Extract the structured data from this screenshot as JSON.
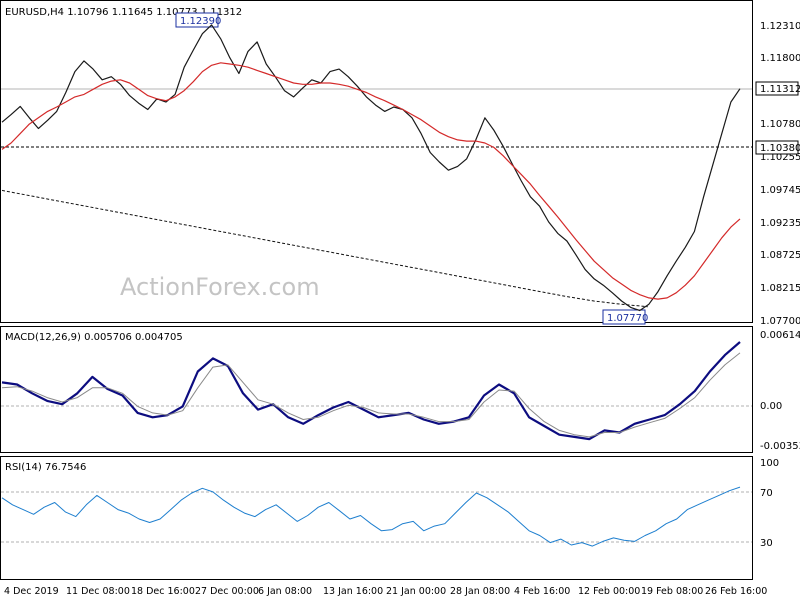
{
  "chart_data": [
    {
      "type": "line",
      "title": "EURUSD,H4  1.10796 1.11645 1.10773 1.11312",
      "ylim": [
        1.0765,
        1.1265
      ],
      "yticks": [
        "1.12310",
        "1.11800",
        "1.11312",
        "1.10780",
        "1.10380",
        "1.10255",
        "1.09745",
        "1.09235",
        "1.08725",
        "1.08215",
        "1.07700"
      ],
      "current_price": "1.11312",
      "horizontal_line_label": "1.10380",
      "high_label": "1.12390",
      "low_label": "1.07770",
      "watermark": "ActionForex.com",
      "x_labels": [
        "4 Dec 2019",
        "11 Dec 08:00",
        "18 Dec 16:00",
        "27 Dec 00:00",
        "6 Jan 08:00",
        "13 Jan 16:00",
        "21 Jan 00:00",
        "28 Jan 08:00",
        "4 Feb 16:00",
        "12 Feb 00:00",
        "19 Feb 08:00",
        "26 Feb 16:00"
      ],
      "series": [
        {
          "name": "price",
          "color": "#1a1a1a",
          "values": [
            1.1078,
            1.109,
            1.1103,
            1.1085,
            1.1068,
            1.1081,
            1.1095,
            1.1125,
            1.1158,
            1.1175,
            1.1162,
            1.1145,
            1.115,
            1.1138,
            1.112,
            1.1108,
            1.1098,
            1.1115,
            1.111,
            1.1122,
            1.1165,
            1.1192,
            1.1218,
            1.1232,
            1.121,
            1.118,
            1.1155,
            1.119,
            1.1205,
            1.117,
            1.115,
            1.1128,
            1.1118,
            1.1132,
            1.1145,
            1.114,
            1.1158,
            1.1162,
            1.115,
            1.1135,
            1.1118,
            1.1105,
            1.1095,
            1.1102,
            1.1098,
            1.1085,
            1.106,
            1.103,
            1.1015,
            1.1002,
            1.1008,
            1.102,
            1.105,
            1.1085,
            1.1065,
            1.104,
            1.1012,
            1.0985,
            1.096,
            1.0945,
            1.092,
            1.0902,
            1.089,
            1.0868,
            1.0845,
            1.083,
            1.082,
            1.0808,
            1.0795,
            1.0785,
            1.078,
            1.079,
            1.081,
            1.0835,
            1.0858,
            1.088,
            1.0905,
            1.096,
            1.101,
            1.106,
            1.111,
            1.1131
          ]
        },
        {
          "name": "ma-red",
          "color": "#d42a2a",
          "values": [
            1.1035,
            1.1045,
            1.106,
            1.1075,
            1.1085,
            1.1095,
            1.1102,
            1.111,
            1.1118,
            1.1122,
            1.113,
            1.1138,
            1.1143,
            1.1145,
            1.114,
            1.113,
            1.112,
            1.1115,
            1.1112,
            1.1118,
            1.1128,
            1.1142,
            1.1158,
            1.1168,
            1.1172,
            1.117,
            1.1168,
            1.1165,
            1.116,
            1.1155,
            1.115,
            1.1145,
            1.114,
            1.1138,
            1.1138,
            1.114,
            1.114,
            1.1138,
            1.1135,
            1.113,
            1.1125,
            1.1118,
            1.1112,
            1.1105,
            1.1098,
            1.109,
            1.1082,
            1.1072,
            1.1062,
            1.1055,
            1.105,
            1.1048,
            1.1048,
            1.1045,
            1.1038,
            1.1025,
            1.101,
            1.0995,
            1.098,
            1.0962,
            1.0945,
            1.0928,
            1.091,
            1.0892,
            1.0875,
            1.0858,
            1.0845,
            1.0832,
            1.0822,
            1.0812,
            1.0805,
            1.08,
            1.0798,
            1.08,
            1.0808,
            1.082,
            1.0835,
            1.0855,
            1.0875,
            1.0895,
            1.0912,
            1.0925
          ]
        },
        {
          "name": "ma-long",
          "color": "#111111",
          "values": [
            1.097,
            1.0962,
            1.0954,
            1.0946,
            1.0938,
            1.093,
            1.0922,
            1.0914,
            1.0906,
            1.0898,
            1.089,
            1.0882,
            1.0874,
            1.0866,
            1.0858,
            1.085,
            1.0842,
            1.0834,
            1.0826,
            1.0818,
            1.081,
            1.0802,
            1.0795,
            1.079,
            1.0786
          ]
        }
      ]
    },
    {
      "type": "line",
      "title": "MACD(12,26,9) 0.005706 0.004705",
      "ylim": [
        -0.0042,
        0.0068
      ],
      "yticks": [
        "0.006146",
        "0.00",
        "-0.003535"
      ],
      "zero_label": "0.00",
      "series": [
        {
          "name": "macd",
          "color": "#0d0d80",
          "values": [
            0.002,
            0.0018,
            0.001,
            0.0003,
            0.0,
            0.001,
            0.0025,
            0.0014,
            0.0008,
            -0.0008,
            -0.0012,
            -0.001,
            -0.0002,
            0.003,
            0.0042,
            0.0035,
            0.001,
            -0.0005,
            0.0,
            -0.0012,
            -0.0018,
            -0.001,
            -0.0003,
            0.0002,
            -0.0005,
            -0.0012,
            -0.001,
            -0.0008,
            -0.0014,
            -0.0018,
            -0.0016,
            -0.0012,
            0.0008,
            0.0018,
            0.001,
            -0.0012,
            -0.002,
            -0.0028,
            -0.003,
            -0.0032,
            -0.0024,
            -0.0026,
            -0.0018,
            -0.0014,
            -0.001,
            0.0,
            0.0012,
            0.003,
            0.0045,
            0.0057
          ]
        },
        {
          "name": "signal",
          "color": "#8a8a8a",
          "values": [
            0.0015,
            0.0016,
            0.0012,
            0.0006,
            0.0002,
            0.0006,
            0.0015,
            0.0015,
            0.001,
            -0.0002,
            -0.0008,
            -0.001,
            -0.0006,
            0.0015,
            0.0034,
            0.0036,
            0.002,
            0.0004,
            0.0,
            -0.0008,
            -0.0014,
            -0.0012,
            -0.0006,
            -0.0001,
            -0.0003,
            -0.0008,
            -0.0009,
            -0.0009,
            -0.0012,
            -0.0016,
            -0.0016,
            -0.0014,
            0.0002,
            0.0013,
            0.0012,
            -0.0004,
            -0.0016,
            -0.0024,
            -0.0028,
            -0.003,
            -0.0026,
            -0.0026,
            -0.0021,
            -0.0017,
            -0.0013,
            -0.0004,
            0.0006,
            0.0022,
            0.0036,
            0.0047
          ]
        }
      ]
    },
    {
      "type": "line",
      "title": "RSI(14) 76.7546",
      "ylim": [
        0,
        100
      ],
      "yticks": [
        "100",
        "70",
        "30",
        "0"
      ],
      "levels": [
        70,
        30
      ],
      "series": [
        {
          "name": "rsi",
          "color": "#1e7fcf",
          "values": [
            68,
            62,
            58,
            54,
            60,
            64,
            56,
            52,
            62,
            70,
            64,
            58,
            55,
            50,
            47,
            50,
            58,
            66,
            72,
            76,
            73,
            66,
            60,
            55,
            52,
            58,
            62,
            55,
            48,
            53,
            60,
            64,
            57,
            50,
            53,
            46,
            40,
            41,
            46,
            48,
            40,
            44,
            46,
            55,
            64,
            72,
            68,
            62,
            56,
            48,
            40,
            36,
            30,
            33,
            28,
            30,
            27,
            31,
            34,
            32,
            31,
            36,
            40,
            46,
            50,
            58,
            62,
            66,
            70,
            74,
            77
          ]
        }
      ]
    }
  ]
}
